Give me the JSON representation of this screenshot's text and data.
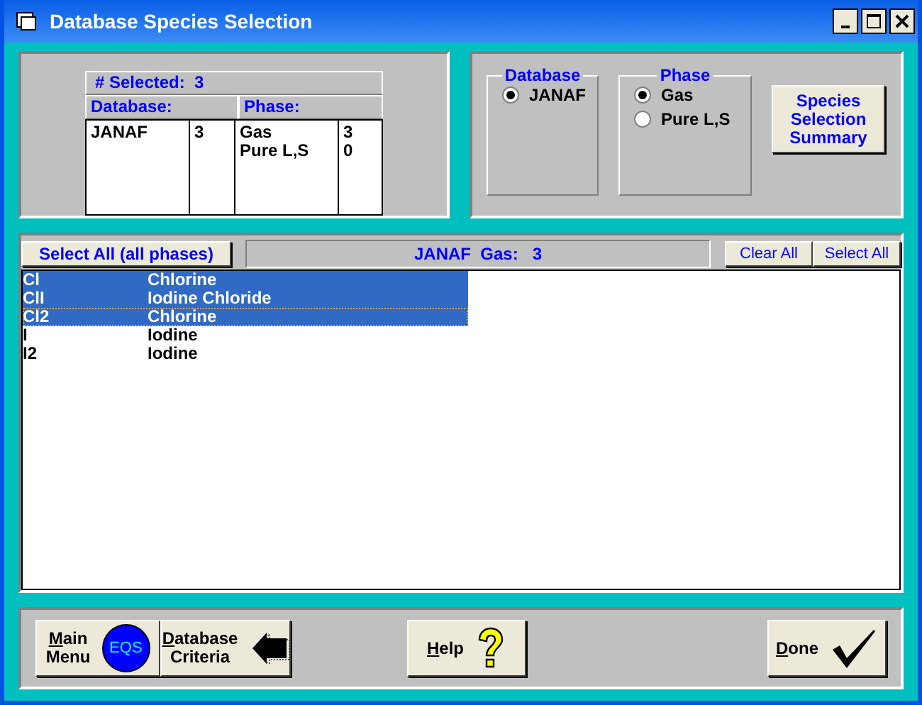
{
  "window": {
    "title": "Database Species Selection"
  },
  "summary": {
    "selected_label": "# Selected:",
    "selected_count": "3",
    "database_heading": "Database:",
    "phase_heading": "Phase:",
    "databases": [
      {
        "name": "JANAF",
        "count": "3"
      }
    ],
    "phases": [
      {
        "name": "Gas",
        "count": "3"
      },
      {
        "name": "Pure L,S",
        "count": "0"
      }
    ]
  },
  "database_group": {
    "title": "Database",
    "options": [
      {
        "label": "JANAF",
        "selected": true
      }
    ]
  },
  "phase_group": {
    "title": "Phase",
    "options": [
      {
        "label": "Gas",
        "selected": true
      },
      {
        "label": "Pure L,S",
        "selected": false
      }
    ]
  },
  "summary_button": "Species\nSelection\nSummary",
  "list_toolbar": {
    "select_all_phases": "Select All (all phases)",
    "status": "JANAF  Gas:   3",
    "clear_all": "Clear All",
    "select_all": "Select All"
  },
  "species": [
    {
      "formula": "Cl",
      "name": "Chlorine",
      "selected": true,
      "focused": false
    },
    {
      "formula": "ClI",
      "name": "Iodine Chloride",
      "selected": true,
      "focused": false
    },
    {
      "formula": "Cl2",
      "name": "Chlorine",
      "selected": true,
      "focused": true
    },
    {
      "formula": "I",
      "name": "Iodine",
      "selected": false,
      "focused": false
    },
    {
      "formula": "I2",
      "name": "Iodine",
      "selected": false,
      "focused": false
    }
  ],
  "buttons": [
    {
      "kind": "main",
      "label": "Main\nMenu",
      "logo": "EQS"
    },
    {
      "kind": "criteria",
      "label": "Database\nCriteria"
    },
    {
      "kind": "help",
      "label": "Help"
    },
    {
      "kind": "done",
      "label": "Done"
    }
  ]
}
